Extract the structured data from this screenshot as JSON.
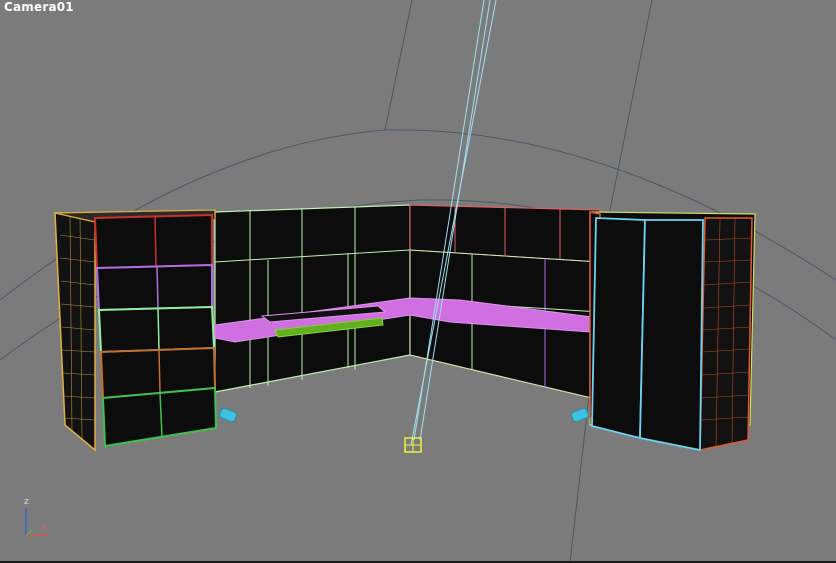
{
  "viewport": {
    "label": "Camera01",
    "background_color": "#7b7b7b"
  },
  "axis_tripod": {
    "z_label": "z",
    "x_label": "x",
    "z_color": "#dddddd",
    "x_color": "#e06060"
  },
  "scene": {
    "object_colors": {
      "left_side_panel": "#e0b040",
      "left_cabinet_top_drawer": "#c83030",
      "left_cabinet_drawer_2": "#b070e0",
      "left_cabinet_drawer_3": "#90f0a0",
      "left_cabinet_drawer_4": "#c07030",
      "left_cabinet_drawer_5": "#40c050",
      "back_wall_panels": "#c0f0b0",
      "right_back_wall_panels": "#e06060",
      "desk_surface": "#d070e0",
      "keyboard_tray": "#60b020",
      "right_cabinet_frame": "#e05a30",
      "right_cabinet_door": "#70d0f0",
      "right_side_panel": "#d0e060",
      "camera_target": "#f0f040",
      "camera_line": "#a0e0f0",
      "feet": "#40c0e0",
      "grid_lines": "#4a5a6a"
    }
  }
}
